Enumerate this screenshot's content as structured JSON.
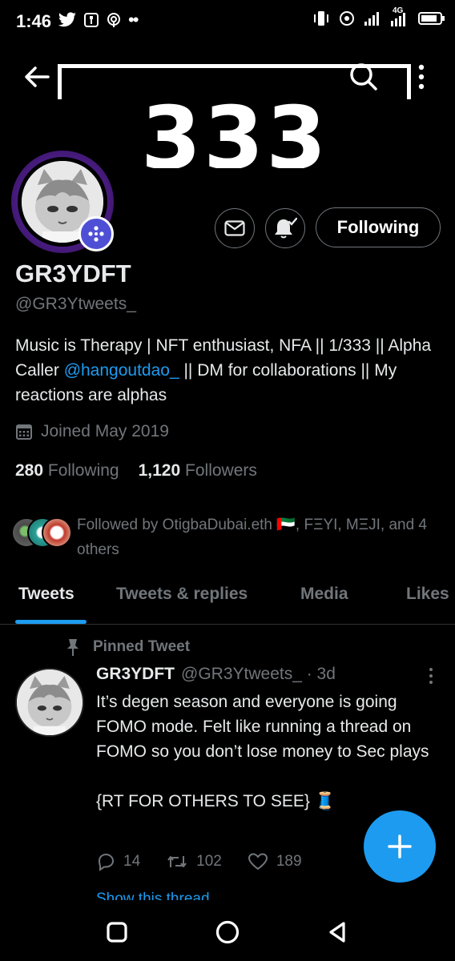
{
  "status_bar": {
    "time": "1:46",
    "left_icons": [
      "twitter-bird-icon",
      "notification-box-icon",
      "hotspot-icon",
      "more-dots-icon"
    ],
    "right_icons": [
      "vibrate-icon",
      "wifi-call-icon",
      "signal-icon",
      "signal-4g-icon",
      "battery-icon"
    ],
    "network_label": "4G"
  },
  "header": {
    "banner_number": "333",
    "back_label": "Back",
    "search_label": "Search",
    "more_label": "More"
  },
  "profile": {
    "name": "GR3YDFT",
    "handle": "@GR3Ytweets_",
    "bio_part1": "Music is Therapy | NFT enthusiast, NFA || 1/333 || Alpha Caller ",
    "bio_mention": "@hangoutdao_",
    "bio_part2": " || DM for collaborations || My reactions are alphas",
    "joined": "Joined May 2019",
    "following_count": "280",
    "following_label": "Following",
    "followers_count": "1,120",
    "followers_label": "Followers",
    "followed_by": "Followed by OtigbaDubai.eth 🇦🇪, FΞYI, MΞJI, and 4 others",
    "following_button": "Following"
  },
  "tabs": [
    {
      "label": "Tweets",
      "active": true
    },
    {
      "label": "Tweets & replies",
      "active": false
    },
    {
      "label": "Media",
      "active": false
    },
    {
      "label": "Likes",
      "active": false
    }
  ],
  "tweet": {
    "pinned_label": "Pinned Tweet",
    "name": "GR3YDFT",
    "handle_time": "@GR3Ytweets_ · 3d",
    "body_line1": "It’s  degen season and everyone is going FOMO mode. Felt like running a thread on FOMO so you don’t lose money to Sec plays",
    "body_line2": "{RT FOR OTHERS TO SEE} 🧵",
    "replies": "14",
    "retweets": "102",
    "likes": "189",
    "show_thread": "Show this thread"
  },
  "colors": {
    "accent": "#1d9bf0",
    "muted": "#71767b",
    "text": "#e7e9ea",
    "avatar_ring": "#4a1c83",
    "badge": "#4f4fd6"
  },
  "battery_level": 0.85
}
